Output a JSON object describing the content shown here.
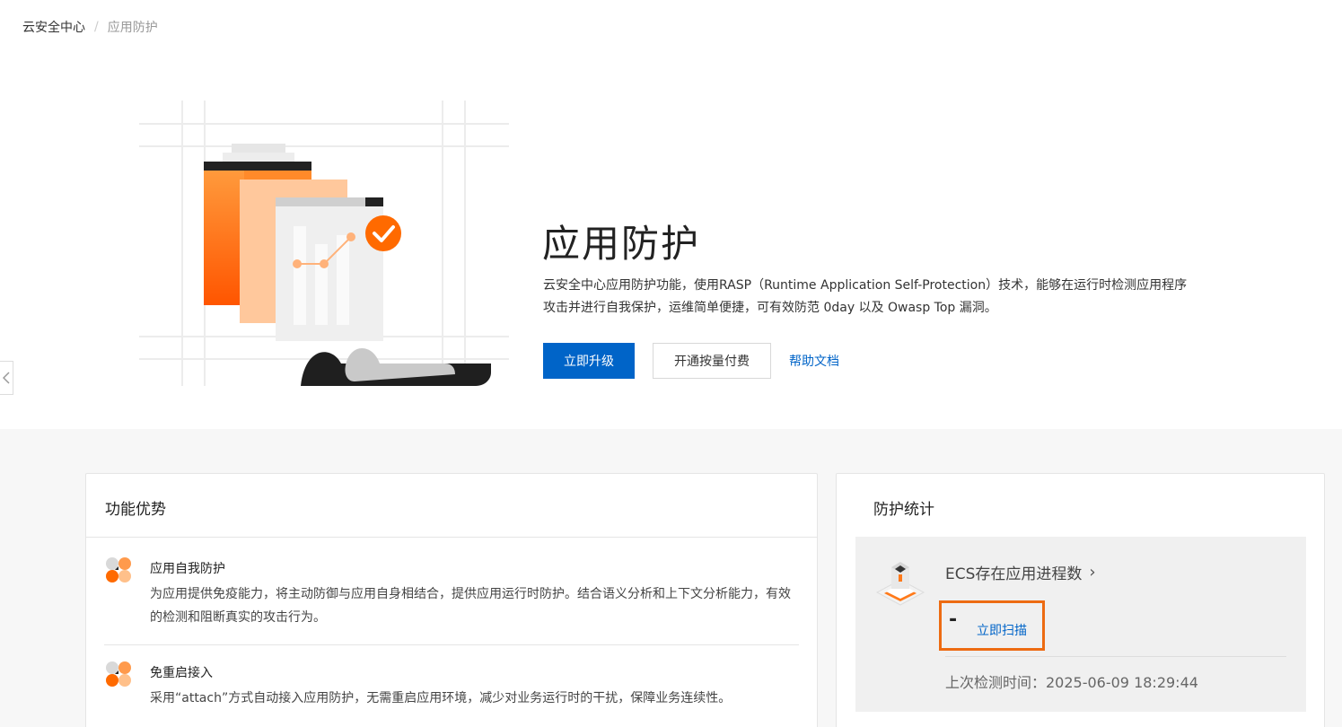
{
  "breadcrumb": {
    "home": "云安全中心",
    "separator": "/",
    "current": "应用防护"
  },
  "hero": {
    "title": "应用防护",
    "description": "云安全中心应用防护功能，使用RASP（Runtime Application Self-Protection）技术，能够在运行时检测应用程序攻击并进行自我保护，运维简单便捷，可有效防范 0day 以及 Owasp Top 漏洞。",
    "upgrade_label": "立即升级",
    "payg_label": "开通按量付费",
    "help_label": "帮助文档"
  },
  "features": {
    "title": "功能优势",
    "items": [
      {
        "title": "应用自我防护",
        "desc": "为应用提供免疫能力，将主动防御与应用自身相结合，提供应用运行时防护。结合语义分析和上下文分析能力，有效的检测和阻断真实的攻击行为。"
      },
      {
        "title": "免重启接入",
        "desc": "采用“attach”方式自动接入应用防护，无需重启应用环境，减少对业务运行时的干扰，保障业务连续性。"
      }
    ]
  },
  "stats": {
    "title": "防护统计",
    "label": "ECS存在应用进程数",
    "chevron": "›",
    "value": "-",
    "scan_label": "立即扫描",
    "last_check": "上次检测时间：2025-06-09 18:29:44"
  },
  "colors": {
    "primary": "#0064c8",
    "accent_orange": "#ff6a00",
    "highlight_border": "#ed6b12"
  }
}
